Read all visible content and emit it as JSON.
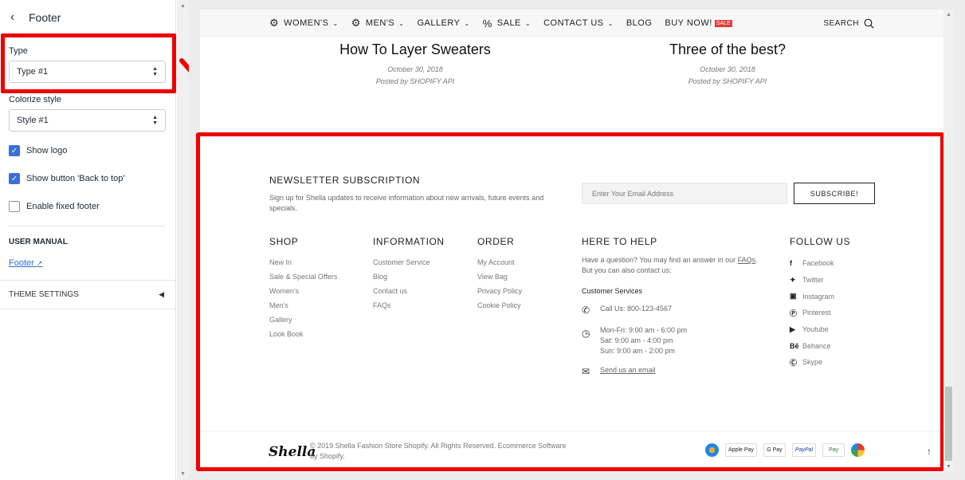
{
  "panel": {
    "back_icon": "chevron-left-icon",
    "title": "Footer",
    "type_label": "Type",
    "type_value": "Type #1",
    "colorize_label": "Colorize style",
    "colorize_value": "Style #1",
    "show_logo_label": "Show logo",
    "show_logo_checked": true,
    "back_to_top_label": "Show button 'Back to top'",
    "back_to_top_checked": true,
    "fixed_footer_label": "Enable fixed footer",
    "fixed_footer_checked": false,
    "user_manual_caption": "USER MANUAL",
    "manual_link": "Footer",
    "theme_settings": "THEME SETTINGS"
  },
  "nav": {
    "items": [
      "WOMEN'S",
      "MEN'S",
      "GALLERY",
      "SALE",
      "CONTACT US",
      "BLOG",
      "BUY NOW!"
    ],
    "sale_badge": "SALE",
    "search": "SEARCH"
  },
  "posts": [
    {
      "title": "How To Layer Sweaters",
      "date": "October 30, 2018",
      "author": "Posted by SHOPIFY API"
    },
    {
      "title": "Three of the best?",
      "date": "October 30, 2018",
      "author": "Posted by SHOPIFY API"
    }
  ],
  "newsletter": {
    "title": "NEWSLETTER SUBSCRIPTION",
    "description": "Sign up for Shella updates to receive information about new arrivals, future events and specials.",
    "placeholder": "Enter Your Email Address",
    "button": "SUBSCRIBE!"
  },
  "columns": {
    "shop": {
      "title": "SHOP",
      "links": [
        "New In",
        "Sale & Special Offers",
        "Women's",
        "Men's",
        "Gallery",
        "Look Book"
      ]
    },
    "information": {
      "title": "INFORMATION",
      "links": [
        "Customer Service",
        "Blog",
        "Contact us",
        "FAQs"
      ]
    },
    "order": {
      "title": "ORDER",
      "links": [
        "My Account",
        "View Bag",
        "Privacy Policy",
        "Cookie Policy"
      ]
    },
    "help": {
      "title": "HERE TO HELP",
      "text_before": "Have a question? You may find an answer in our ",
      "faqs": "FAQs",
      "text_after": ".",
      "contact_line": "But you can also contact us:",
      "customer_services": "Customer Services",
      "phone": "Call Us: 800-123-4567",
      "hours": [
        "Mon-Fri: 9:00 am - 6:00 pm",
        "Sat: 9:00 am - 4:00 pm",
        "Sun: 9:00 am - 2:00 pm"
      ],
      "email": "Send us an email"
    },
    "follow": {
      "title": "FOLLOW US",
      "links": [
        "Facebook",
        "Twitter",
        "Instagram",
        "Pinterest",
        "Youtube",
        "Behance",
        "Skype"
      ]
    }
  },
  "bottom": {
    "logo": "Shella",
    "copyright": "© 2019 Shella Fashion Store Shopify. All Rights Reserved. Ecommerce Software by Shopify.",
    "payments": [
      "Apple Pay",
      "G Pay",
      "PayPal",
      "Pay"
    ]
  }
}
